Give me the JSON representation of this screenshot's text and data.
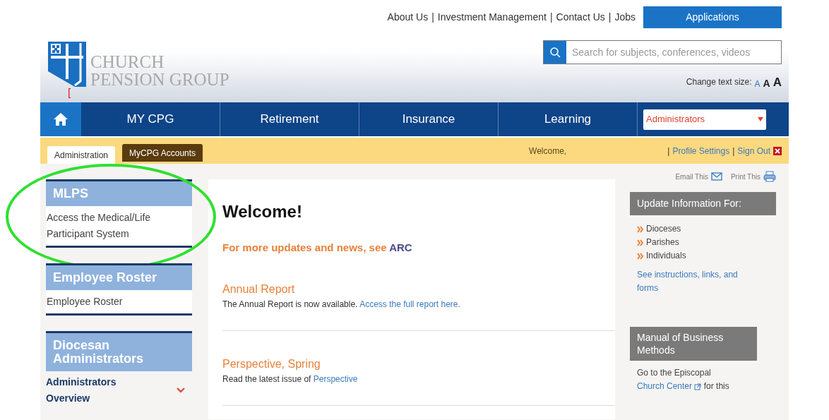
{
  "header": {
    "logo_lines": [
      "CHURCH",
      "PENSION GROUP"
    ],
    "separator": "|",
    "top_links": [
      "About Us",
      "Investment Management",
      "Contact Us",
      "Jobs"
    ],
    "applications_button": "Applications",
    "search": {
      "placeholder": "Search for subjects, conferences, videos"
    },
    "stray_mark": "[",
    "text_size": {
      "label": "Change text size:",
      "options": [
        "A",
        "A",
        "A"
      ]
    }
  },
  "nav": {
    "items": [
      {
        "kind": "home"
      },
      {
        "kind": "link",
        "label": "MY CPG"
      },
      {
        "kind": "link",
        "label": "Retirement"
      },
      {
        "kind": "link",
        "label": "Insurance"
      },
      {
        "kind": "link",
        "label": "Learning"
      }
    ],
    "select": {
      "value": "Administrators"
    }
  },
  "subbar": {
    "tabs": [
      {
        "label": "Administration",
        "selected": true
      },
      {
        "label": "MyCPG Accounts",
        "selected": false
      }
    ],
    "welcome": "Welcome,",
    "separator": "|",
    "links": [
      "Profile Settings",
      "Sign Out"
    ]
  },
  "sidebar": {
    "highlight": {
      "kind": "ellipse"
    },
    "sections": [
      {
        "title": "MLPS",
        "items": [
          {
            "kind": "text",
            "text": "Access the Medical/Life Participant System"
          }
        ]
      },
      {
        "title": "Employee Roster",
        "items": [
          {
            "kind": "text",
            "text": "Employee Roster"
          }
        ]
      },
      {
        "title": "Diocesan Administrators",
        "items": [
          {
            "kind": "expandable",
            "text": "Administrators Overview",
            "expanded": false
          }
        ]
      }
    ]
  },
  "main": {
    "heading": "Welcome!",
    "intro": {
      "text": "For more updates and news, see",
      "link": "ARC"
    },
    "news": [
      {
        "title": "Annual Report",
        "text": "The Annual Report is now available.",
        "link": "Access the full report here."
      },
      {
        "title": "Perspective, Spring",
        "text": "Read the latest issue of",
        "link": "Perspective"
      }
    ]
  },
  "aside": {
    "actions": [
      {
        "kind": "email",
        "label": "Email This"
      },
      {
        "kind": "print",
        "label": "Print This"
      }
    ],
    "update_box": {
      "title": "Update Information For:",
      "items": [
        "Dioceses",
        "Parishes",
        "Individuals"
      ],
      "link": "See instructions, links, and forms"
    },
    "manual_box": {
      "title": "Manual of Business Methods",
      "text": "Go to the Episcopal",
      "link": "Church Center",
      "after": "for this"
    }
  }
}
